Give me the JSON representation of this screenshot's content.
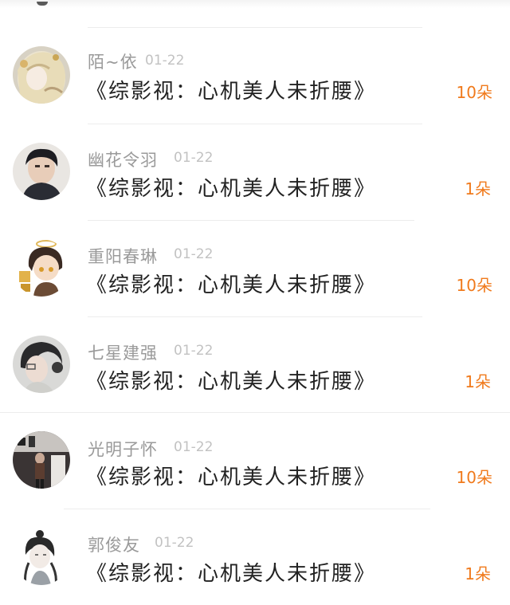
{
  "colors": {
    "accent_orange": "#f07a1c",
    "name_gray": "#9a9a9a",
    "date_gray": "#c2c2c2",
    "text_dark": "#222222"
  },
  "entries": [
    {
      "name": "陌~依",
      "date": "01-22",
      "message": "《综影视：心机美人未折腰》",
      "count": "10朵",
      "avatar": "anime-girl-avatar"
    },
    {
      "name": "幽花令羽",
      "date": "01-22",
      "message": "《综影视：心机美人未折腰》",
      "count": "1朵",
      "avatar": "boy-photo-avatar"
    },
    {
      "name": "重阳春琳",
      "date": "01-22",
      "message": "《综影视：心机美人未折腰》",
      "count": "10朵",
      "avatar": "chibi-character-avatar"
    },
    {
      "name": "七星建强",
      "date": "01-22",
      "message": "《综影视：心机美人未折腰》",
      "count": "1朵",
      "avatar": "girl-profile-photo-avatar"
    },
    {
      "name": "光明子怀",
      "date": "01-22",
      "message": "《综影视：心机美人未折腰》",
      "count": "10朵",
      "avatar": "street-photo-avatar"
    },
    {
      "name": "郭俊友",
      "date": "01-22",
      "message": "《综影视：心机美人未折腰》",
      "count": "1朵",
      "avatar": "ink-sketch-man-avatar"
    }
  ]
}
